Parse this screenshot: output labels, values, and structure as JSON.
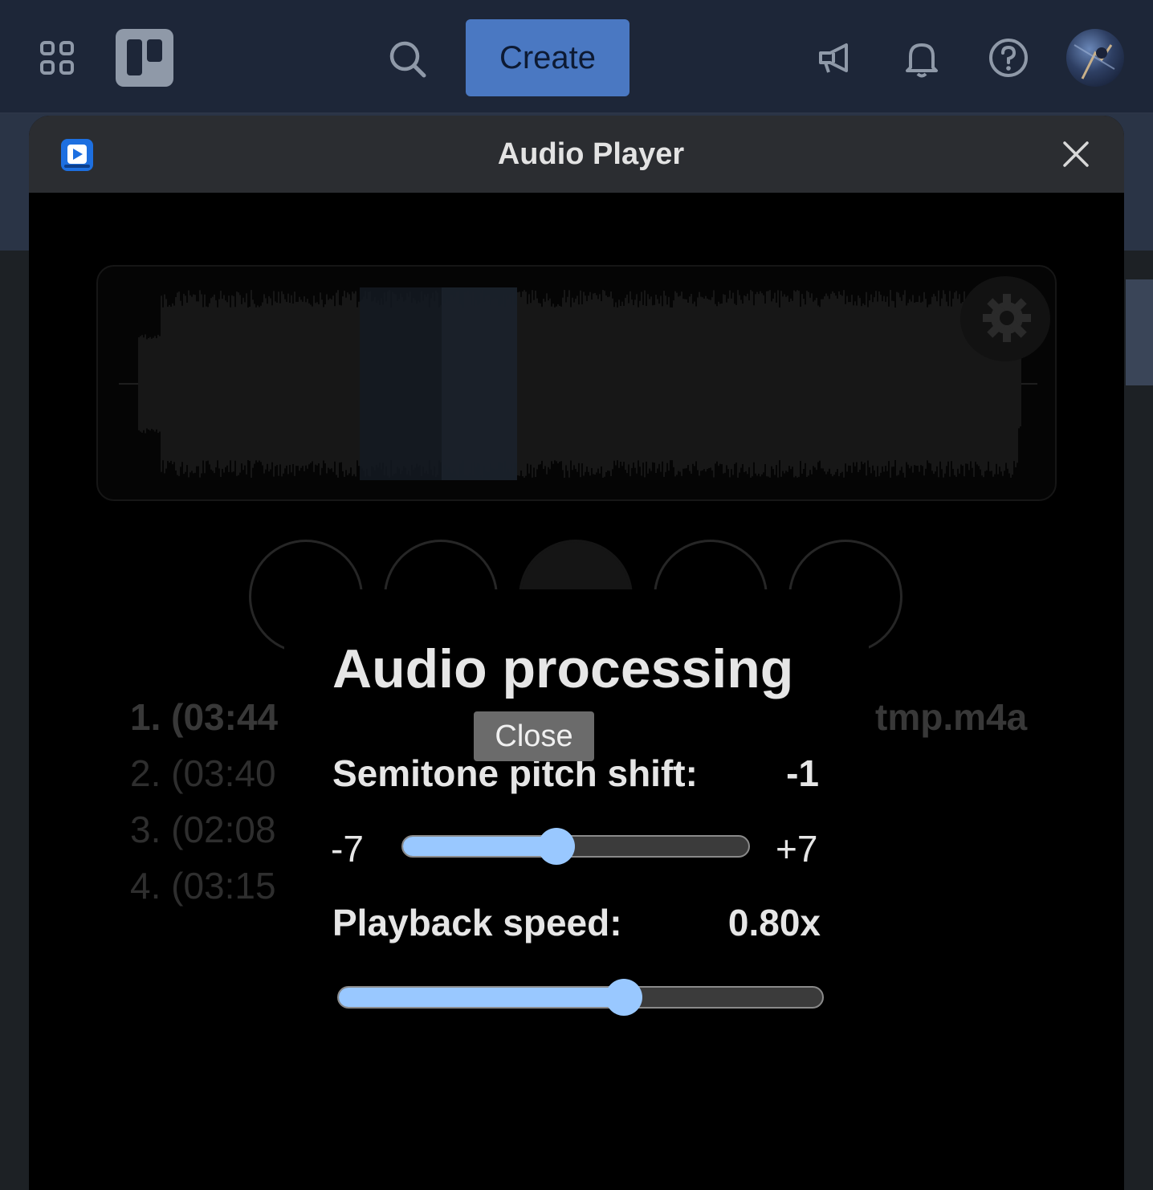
{
  "topbar": {
    "icons": [
      "apps-grid-icon",
      "trello-logo",
      "search-icon",
      "megaphone-icon",
      "bell-icon",
      "help-icon",
      "avatar"
    ],
    "create_label": "Create",
    "accent_color": "#4a78c2"
  },
  "window": {
    "title": "Audio Player",
    "icons": [
      "audio-player-app-icon",
      "close-icon"
    ]
  },
  "player": {
    "controls": [
      "skip-back-icon",
      "play-icon",
      "ab-loop-button",
      "stop-icon",
      "skip-forward-icon"
    ],
    "tracks": [
      {
        "label": "1. (03:44"
      },
      {
        "label": "2. (03:40"
      },
      {
        "label": "3. (02:08"
      },
      {
        "label": "4. (03:15"
      }
    ],
    "current_file": "tmp.m4a"
  },
  "dialog": {
    "title": "Audio processing",
    "pitch": {
      "label": "Semitone pitch shift:",
      "value": "-1",
      "min_label": "-7",
      "max_label": "+7",
      "fraction": 0.444
    },
    "speed": {
      "label": "Playback speed:",
      "value": "0.80x",
      "fraction": 0.59
    },
    "close_label": "Close",
    "slider_color": "#99c8ff"
  }
}
